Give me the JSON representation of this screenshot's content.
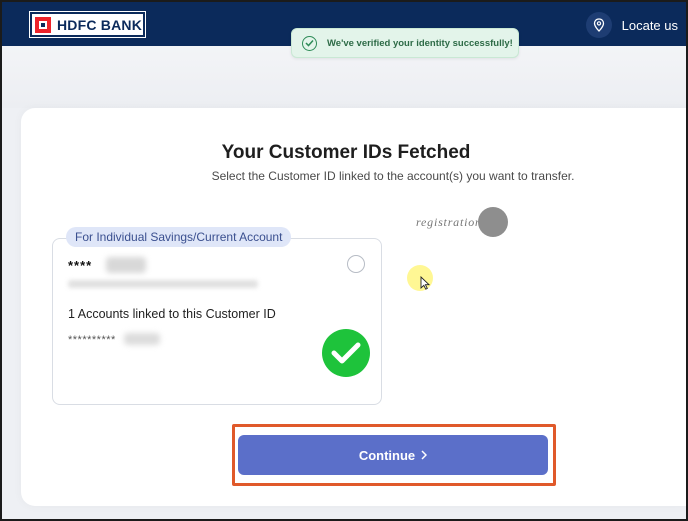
{
  "header": {
    "logo_text": "HDFC BANK",
    "locate_label": "Locate us"
  },
  "toast": {
    "message": "We've verified your identity successfully!"
  },
  "main": {
    "title": "Your Customer IDs Fetched",
    "subtitle": "Select the Customer ID linked to the account(s) you want to transfer."
  },
  "account": {
    "tag": "For Individual Savings/Current Account",
    "customer_id_masked": "****",
    "linked_text": "1 Accounts linked to this Customer ID",
    "account_masked": "**********"
  },
  "watermark": {
    "text": "registration"
  },
  "actions": {
    "continue_label": "Continue"
  },
  "colors": {
    "header_bg": "#0b2a5b",
    "brand_red": "#ed232a",
    "primary_button": "#5b6fc9",
    "success_green": "#1ec33b",
    "highlight_orange": "#e0592a"
  },
  "icons": {
    "pin": "location-pin-icon",
    "toast": "check-circle-icon",
    "selected": "check-circle-filled-icon",
    "chevron": "chevron-right-icon"
  }
}
